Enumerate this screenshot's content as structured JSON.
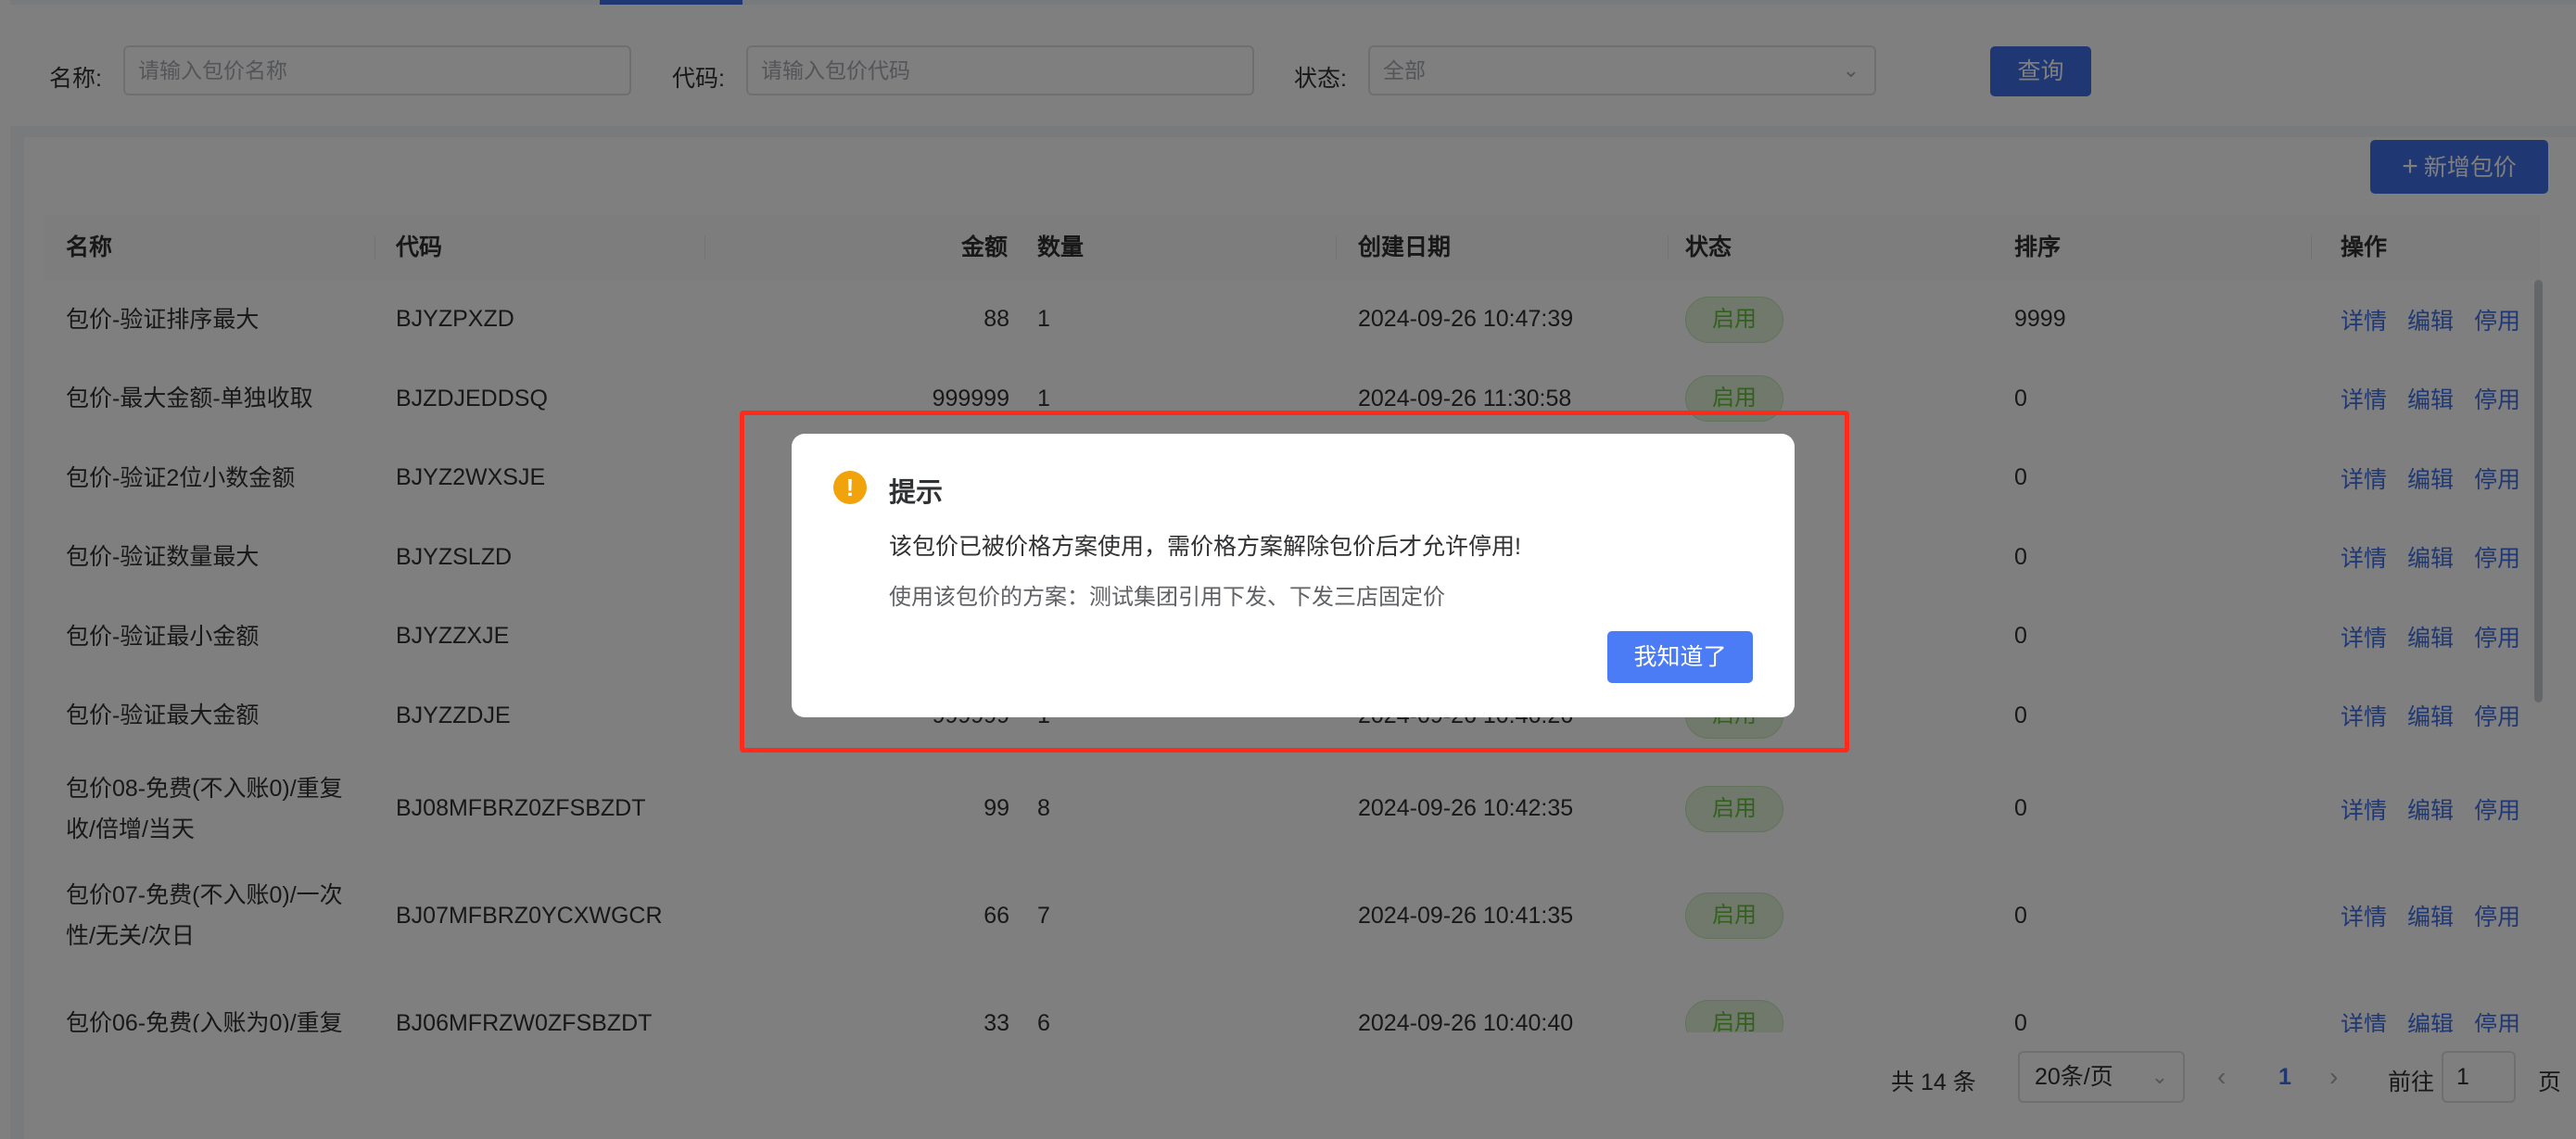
{
  "filters": {
    "name_label": "名称:",
    "name_placeholder": "请输入包价名称",
    "code_label": "代码:",
    "code_placeholder": "请输入包价代码",
    "status_label": "状态:",
    "status_value": "全部",
    "query_label": "查询"
  },
  "toolbar": {
    "add_label": "新增包价"
  },
  "table": {
    "columns": {
      "name": "名称",
      "code": "代码",
      "amount": "金额",
      "qty": "数量",
      "date": "创建日期",
      "status": "状态",
      "sort": "排序",
      "ops": "操作"
    },
    "ops": {
      "detail": "详情",
      "edit": "编辑",
      "disable": "停用"
    },
    "rows": [
      {
        "name": "包价-验证排序最大",
        "code": "BJYZPXZD",
        "amount": "88",
        "qty": "1",
        "date": "2024-09-26 10:47:39",
        "status": "启用",
        "sort": "9999"
      },
      {
        "name": "包价-最大金额-单独收取",
        "code": "BJZDJEDDSQ",
        "amount": "999999",
        "qty": "1",
        "date": "2024-09-26 11:30:58",
        "status": "启用",
        "sort": "0"
      },
      {
        "name": "包价-验证2位小数金额",
        "code": "BJYZ2WXSJE",
        "amount": "",
        "qty": "",
        "date": "",
        "status": "",
        "sort": "0"
      },
      {
        "name": "包价-验证数量最大",
        "code": "BJYZSLZD",
        "amount": "",
        "qty": "",
        "date": "",
        "status": "",
        "sort": "0"
      },
      {
        "name": "包价-验证最小金额",
        "code": "BJYZZXJE",
        "amount": "",
        "qty": "",
        "date": "",
        "status": "",
        "sort": "0"
      },
      {
        "name": "包价-验证最大金额",
        "code": "BJYZZDJE",
        "amount": "999999",
        "qty": "1",
        "date": "2024-09-26 10:46:26",
        "status": "启用",
        "sort": "0"
      },
      {
        "name": "包价08-免费(不入账0)/重复收/倍增/当天",
        "code": "BJ08MFBRZ0ZFSBZDT",
        "amount": "99",
        "qty": "8",
        "date": "2024-09-26 10:42:35",
        "status": "启用",
        "sort": "0"
      },
      {
        "name": "包价07-免费(不入账0)/一次性/无关/次日",
        "code": "BJ07MFBRZ0YCXWGCR",
        "amount": "66",
        "qty": "7",
        "date": "2024-09-26 10:41:35",
        "status": "启用",
        "sort": "0"
      },
      {
        "name": "包价06-免费(入账为0)/重复",
        "code": "BJ06MFRZW0ZFSBZDT",
        "amount": "33",
        "qty": "6",
        "date": "2024-09-26 10:40:40",
        "status": "启用",
        "sort": "0"
      }
    ]
  },
  "pagination": {
    "total": "共 14 条",
    "page_size": "20条/页",
    "prev": "‹",
    "next": "›",
    "current": "1",
    "goto_label": "前往",
    "goto_value": "1",
    "page_suffix": "页"
  },
  "dialog": {
    "icon": "!",
    "title": "提示",
    "message": "该包价已被价格方案使用，需价格方案解除包价后才允许停用!",
    "sub_message": "使用该包价的方案：测试集团引用下发、下发三店固定价",
    "ok_label": "我知道了"
  },
  "colors": {
    "primary": "#3f6fe6",
    "warning": "#f0a30a",
    "success": "#67c23a",
    "highlight": "#ff2a1a"
  }
}
